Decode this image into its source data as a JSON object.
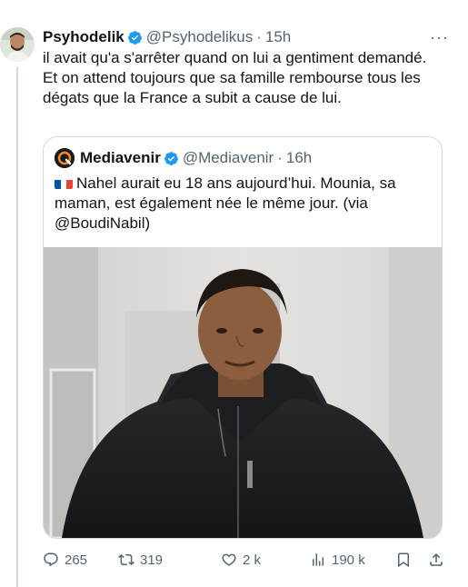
{
  "tweet": {
    "author_name": "Psyhodelik",
    "handle": "@Psyhodelikus",
    "separator": "·",
    "time": "15h",
    "more": "···",
    "text_line1": "il avait qu'a s'arrêter quand on lui a gentiment demandé.",
    "text_line2": "Et on attend toujours que sa famille rembourse tous les dégats que la France a subit a cause de lui."
  },
  "quote": {
    "author_name": "Mediavenir",
    "handle": "@Mediavenir",
    "separator": "·",
    "time": "16h",
    "text": "Nahel aurait eu 18 ans aujourd’hui. Mounia, sa maman, est également née le même jour. (via @BoudiNabil)"
  },
  "actions": {
    "replies": "265",
    "retweets": "319",
    "likes": "2 k",
    "views": "190 k"
  },
  "colors": {
    "verified": "#1d9bf0",
    "secondary_text": "#536471",
    "border": "#cfd9de",
    "flag_blue": "#0055a4",
    "flag_red": "#ef4135"
  }
}
